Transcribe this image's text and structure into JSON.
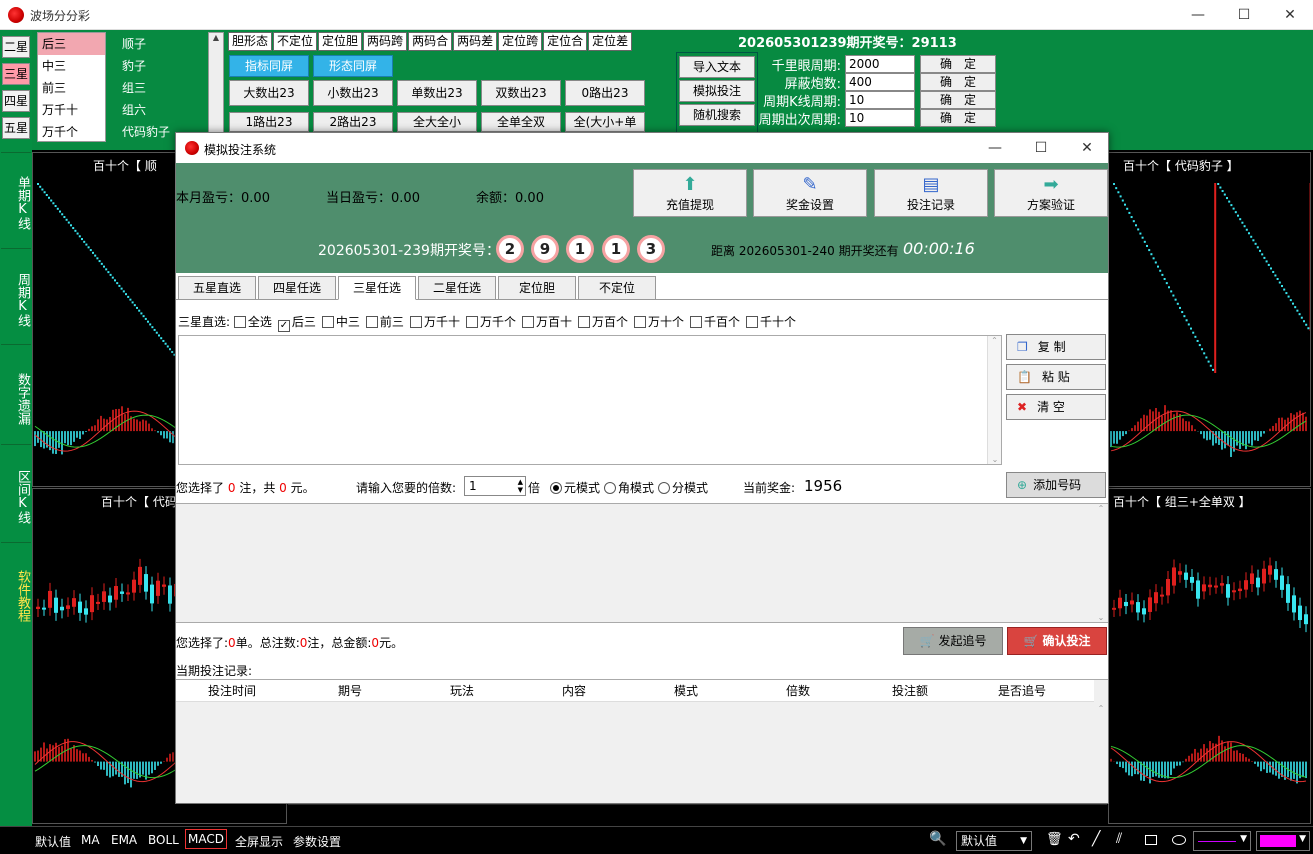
{
  "app": {
    "title": "波场分分彩"
  },
  "stars": [
    "二星",
    "三星",
    "四星",
    "五星"
  ],
  "vnav": [
    "单期K线",
    "周期K线",
    "数字遗漏",
    "区间K线",
    "软件教程"
  ],
  "pos_list": [
    "后三",
    "中三",
    "前三",
    "万千十",
    "万千个"
  ],
  "type_list": [
    "顺子",
    "豹子",
    "组三",
    "组六",
    "代码豹子"
  ],
  "top_tabs": [
    "胆形态",
    "不定位",
    "定位胆",
    "两码跨",
    "两码合",
    "两码差",
    "定位跨",
    "定位合",
    "定位差"
  ],
  "draw_info": "202605301239期开奖号：29113",
  "blue_buttons": [
    "指标同屏",
    "形态同屏"
  ],
  "grid_buttons": [
    "大数出23",
    "小数出23",
    "单数出23",
    "双数出23",
    "0路出23",
    "1路出23",
    "2路出23",
    "全大全小",
    "全单全双",
    "全(大小+单双)"
  ],
  "mid_buttons": [
    "导入文本",
    "模拟投注",
    "随机搜索"
  ],
  "mid_partial": [
    "导...",
    "组..."
  ],
  "settings": [
    {
      "label": "千里眼周期:",
      "value": "2000",
      "btn": "确　定"
    },
    {
      "label": "屏蔽炮数:",
      "value": "400",
      "btn": "确　定"
    },
    {
      "label": "周期K线周期:",
      "value": "10",
      "btn": "确　定"
    },
    {
      "label": "周期出次周期:",
      "value": "10",
      "btn": "确　定"
    }
  ],
  "chart_titles": {
    "tl": "百十个【 顺",
    "tr": "百十个【 代码豹子 】",
    "ml": "百十个【 代码",
    "mr": "百十个【 组三+全单双 】"
  },
  "bottom": {
    "items": [
      "默认值",
      "MA",
      "EMA",
      "BOLL",
      "MACD",
      "全屏显示",
      "参数设置"
    ],
    "selected": "MACD",
    "combo": "默认值"
  },
  "dialog": {
    "title": "模拟投注系统",
    "month_pnl_label": "本月盈亏：",
    "month_pnl": "0.00",
    "day_pnl_label": "当日盈亏：",
    "day_pnl": "0.00",
    "balance_label": "余额：",
    "balance": "0.00",
    "buttons": [
      "充值提现",
      "奖金设置",
      "投注记录",
      "方案验证"
    ],
    "period": "202605301-239",
    "period_suffix": "期开奖号：",
    "balls": [
      "2",
      "9",
      "1",
      "1",
      "3"
    ],
    "countdown_label": "距离 202605301-240 期开奖还有",
    "countdown": "00:00:16",
    "tabs": [
      "五星直选",
      "四星任选",
      "三星任选",
      "二星任选",
      "定位胆",
      "不定位"
    ],
    "selected_tab": "三星任选",
    "group_label": "三星直选:",
    "checks": [
      {
        "label": "全选",
        "checked": false
      },
      {
        "label": "后三",
        "checked": true
      },
      {
        "label": "中三",
        "checked": false
      },
      {
        "label": "前三",
        "checked": false
      },
      {
        "label": "万千十",
        "checked": false
      },
      {
        "label": "万千个",
        "checked": false
      },
      {
        "label": "万百十",
        "checked": false
      },
      {
        "label": "万百个",
        "checked": false
      },
      {
        "label": "万十个",
        "checked": false
      },
      {
        "label": "千百个",
        "checked": false
      },
      {
        "label": "千十个",
        "checked": false
      }
    ],
    "side_buttons": [
      "复 制",
      "粘 贴",
      "清 空"
    ],
    "sel_a": "您选择了",
    "sel_n": "0",
    "sel_b": "注，共",
    "sel_m": "0",
    "sel_c": "元。",
    "mult_label": "请输入您要的倍数:",
    "mult_value": "1",
    "mult_unit": "倍",
    "modes": [
      {
        "label": "元模式",
        "on": true
      },
      {
        "label": "角模式",
        "on": false
      },
      {
        "label": "分模式",
        "on": false
      }
    ],
    "prize_label": "当前奖金:",
    "prize": "1956",
    "add_button": "添加号码",
    "sum_a": "您选择了:",
    "sum_n1": "0",
    "sum_b": "单。总注数:",
    "sum_n2": "0",
    "sum_c": "注，总金额:",
    "sum_n3": "0",
    "sum_d": "元。",
    "chase_button": "发起追号",
    "confirm_button": "确认投注",
    "records_label": "当期投注记录:",
    "columns": [
      "投注时间",
      "期号",
      "玩法",
      "内容",
      "模式",
      "倍数",
      "投注额",
      "是否追号"
    ]
  },
  "colors": {
    "green": "#078a41",
    "cyan": "#39e6f0",
    "red": "#e0201e",
    "selpink": "#f2a7b0",
    "headgreen": "#4f8e6d",
    "confirm": "#d9443f"
  }
}
